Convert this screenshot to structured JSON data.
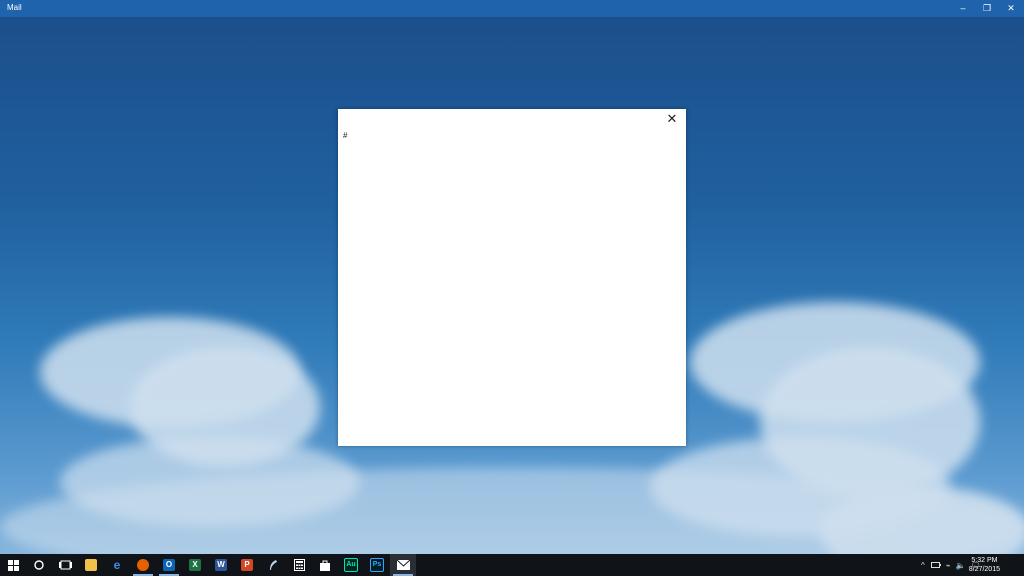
{
  "window": {
    "title": "Mail",
    "controls": {
      "minimize": "–",
      "restore": "❐",
      "close": "✕"
    }
  },
  "dialog": {
    "close_glyph": "✕",
    "content": "#"
  },
  "taskbar": {
    "icons": [
      "windows-start-icon",
      "cortana-icon",
      "task-view-icon",
      "file-explorer-icon",
      "edge-icon",
      "firefox-icon",
      "outlook-icon",
      "excel-icon",
      "word-icon",
      "powerpoint-icon",
      "feather-icon",
      "calculator-icon",
      "store-icon",
      "audition-icon",
      "photoshop-icon",
      "mail-icon"
    ],
    "labels": {
      "outlook": "O",
      "excel": "X",
      "word": "W",
      "powerpoint": "P",
      "audition": "Au",
      "photoshop": "Ps"
    },
    "tray": {
      "chevron": "^",
      "network": "⌁",
      "volume": "🔈",
      "notifications": "🗨"
    },
    "clock": {
      "time": "5:32 PM",
      "date": "8/27/2015"
    }
  },
  "colors": {
    "titlebar": "#1f63ad",
    "taskbar": "#101418"
  }
}
